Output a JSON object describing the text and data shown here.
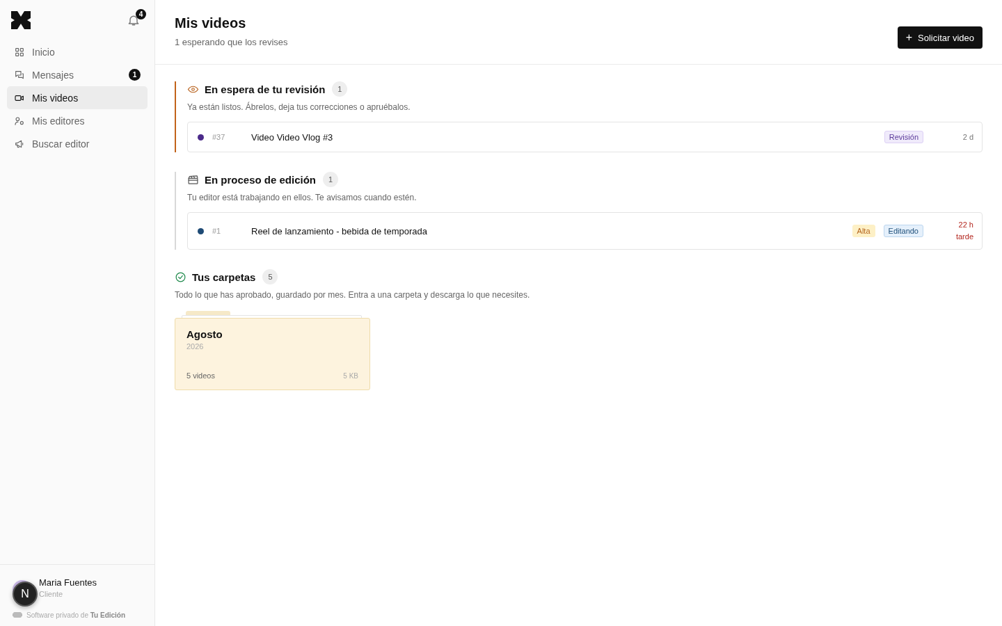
{
  "sidebar": {
    "notifications": "4",
    "items": [
      {
        "label": "Inicio",
        "kind": "home",
        "selected": false
      },
      {
        "label": "Mensajes",
        "kind": "messages",
        "selected": false,
        "badge": "1"
      },
      {
        "label": "Mis videos",
        "kind": "videos",
        "selected": true
      },
      {
        "label": "Mis editores",
        "kind": "editors",
        "selected": false
      },
      {
        "label": "Buscar editor",
        "kind": "search",
        "selected": false
      }
    ],
    "user": {
      "name": "Maria Fuentes",
      "role": "Cliente"
    },
    "footer": "Software privado de **Tu Edición**",
    "dev_badge": "N"
  },
  "header": {
    "title": "Mis videos",
    "subtitle": "1 esperando que los revises",
    "button": "+",
    "button_label": "Solicitar video"
  },
  "sections": [
    {
      "kind": "review",
      "title": "En espera de tu revisión",
      "count": "1",
      "description": "Ya están listos. Ábrelos, deja tus correcciones o apruébalos.",
      "rows": [
        {
          "color": "#4b2a8a",
          "number": "#37",
          "title": "Video Video Vlog #3",
          "tags": [
            {
              "kind": "review",
              "label": "Revisión"
            }
          ],
          "time": [
            "2 d"
          ],
          "late": false
        }
      ]
    },
    {
      "kind": "editing",
      "title": "En proceso de edición",
      "count": "1",
      "description": "Tu editor está trabajando en ellos. Te avisamos cuando estén.",
      "rows": [
        {
          "color": "#1e4a75",
          "number": "#1",
          "title": "Reel de lanzamiento - bebida de temporada",
          "tags": [
            {
              "kind": "priority",
              "label": "Alta"
            },
            {
              "kind": "status",
              "label": "Editando"
            }
          ],
          "time": [
            "22 h",
            "tarde"
          ],
          "late": true
        }
      ]
    },
    {
      "kind": "folders",
      "title": "Tus carpetas",
      "count": "5",
      "description": "Todo lo que has aprobado, guardado por mes. Entra a una carpeta y descarga lo que necesites.",
      "folders": [
        {
          "name": "Agosto",
          "year": "2026",
          "videos": "5 videos",
          "size": "5 KB"
        }
      ]
    }
  ]
}
